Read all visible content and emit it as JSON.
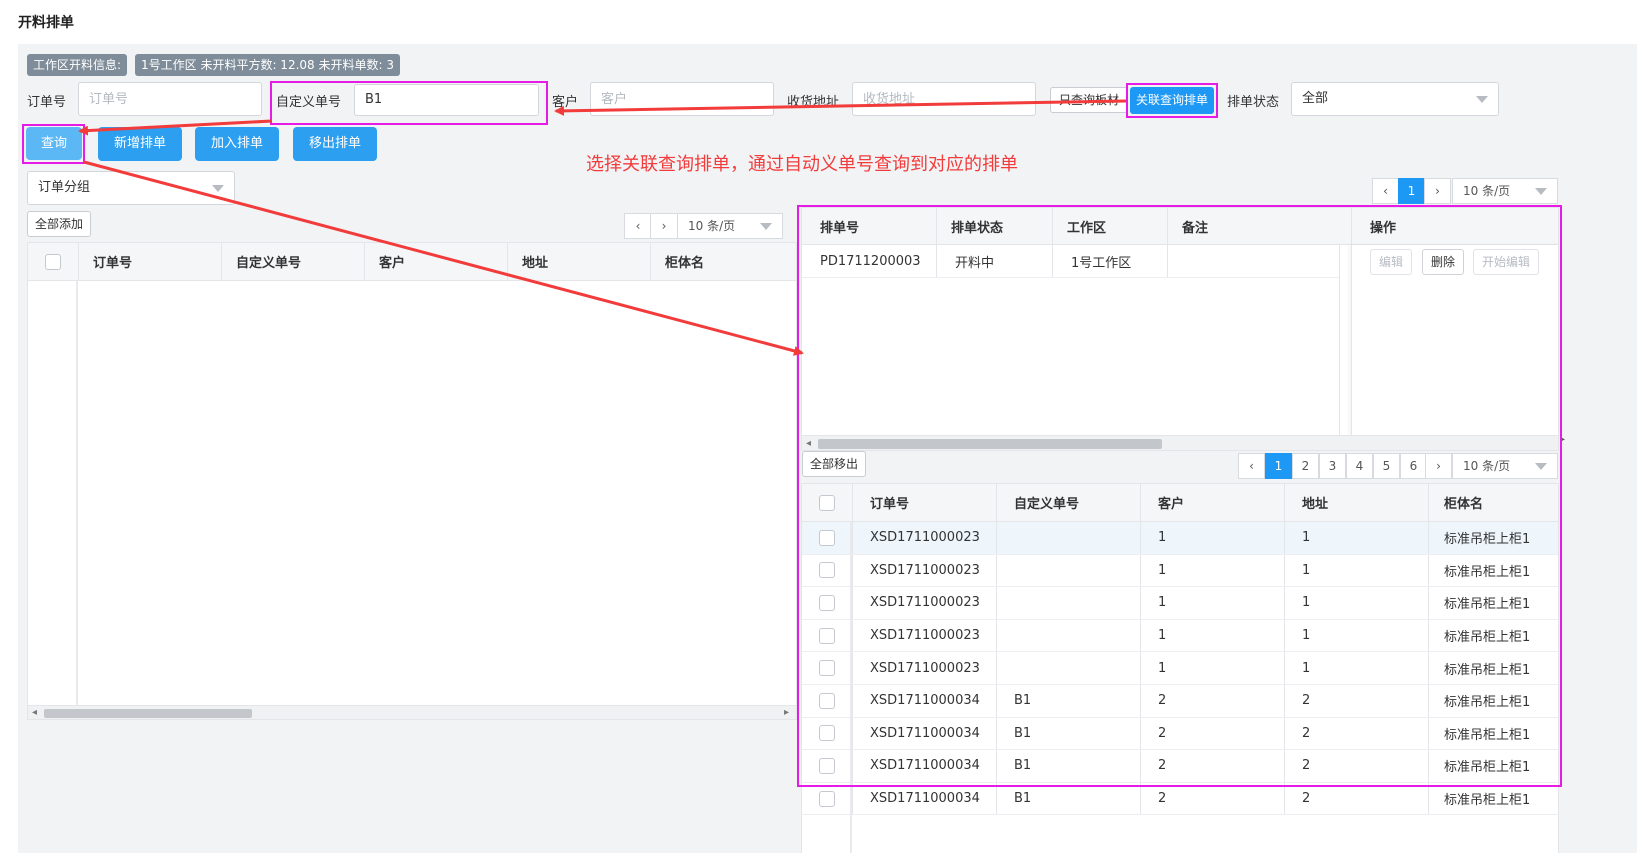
{
  "page": {
    "title": "开料排单"
  },
  "info": {
    "label": "工作区开料信息:",
    "value": "1号工作区 未开料平方数: 12.08 未开料单数: 3"
  },
  "filters": {
    "order_no": {
      "label": "订单号",
      "placeholder": "订单号"
    },
    "custom_no": {
      "label": "自定义单号",
      "value": "B1"
    },
    "customer": {
      "label": "客户",
      "placeholder": "客户"
    },
    "address": {
      "label": "收货地址",
      "placeholder": "收货地址"
    },
    "only_board": "只查询板材",
    "linked_query": "关联查询排单",
    "status": {
      "label": "排单状态",
      "value": "全部"
    }
  },
  "actions": {
    "query": "查询",
    "new": "新增排单",
    "add": "加入排单",
    "remove": "移出排单"
  },
  "annotation": "选择关联查询排单，通过自动义单号查询到对应的排单",
  "left": {
    "group_select": "订单分组",
    "add_all": "全部添加",
    "page_size": "10 条/页",
    "headers": [
      "订单号",
      "自定义单号",
      "客户",
      "地址",
      "柜体名"
    ]
  },
  "right_top": {
    "page": "1",
    "page_size": "10 条/页",
    "headers": [
      "排单号",
      "排单状态",
      "工作区",
      "备注",
      "操作"
    ],
    "rows": [
      {
        "no": "PD1711200003",
        "status": "开料中",
        "zone": "1号工作区",
        "note": ""
      }
    ],
    "ops": [
      "编辑",
      "删除",
      "开始编辑"
    ]
  },
  "right_bottom": {
    "remove_all": "全部移出",
    "pages": [
      "1",
      "2",
      "3",
      "4",
      "5",
      "6"
    ],
    "page_size": "10 条/页",
    "headers": [
      "订单号",
      "自定义单号",
      "客户",
      "地址",
      "柜体名"
    ],
    "rows": [
      {
        "order": "XSD1711000023",
        "custom": "",
        "customer": "1",
        "addr": "1",
        "cabinet": "标准吊柜上柜1"
      },
      {
        "order": "XSD1711000023",
        "custom": "",
        "customer": "1",
        "addr": "1",
        "cabinet": "标准吊柜上柜1"
      },
      {
        "order": "XSD1711000023",
        "custom": "",
        "customer": "1",
        "addr": "1",
        "cabinet": "标准吊柜上柜1"
      },
      {
        "order": "XSD1711000023",
        "custom": "",
        "customer": "1",
        "addr": "1",
        "cabinet": "标准吊柜上柜1"
      },
      {
        "order": "XSD1711000023",
        "custom": "",
        "customer": "1",
        "addr": "1",
        "cabinet": "标准吊柜上柜1"
      },
      {
        "order": "XSD1711000034",
        "custom": "B1",
        "customer": "2",
        "addr": "2",
        "cabinet": "标准吊柜上柜1"
      },
      {
        "order": "XSD1711000034",
        "custom": "B1",
        "customer": "2",
        "addr": "2",
        "cabinet": "标准吊柜上柜1"
      },
      {
        "order": "XSD1711000034",
        "custom": "B1",
        "customer": "2",
        "addr": "2",
        "cabinet": "标准吊柜上柜1"
      },
      {
        "order": "XSD1711000034",
        "custom": "B1",
        "customer": "2",
        "addr": "2",
        "cabinet": "标准吊柜上柜1"
      }
    ]
  },
  "colors": {
    "accent": "#2d9ff0",
    "highlight_box": "#e61be6",
    "arrow": "#f23b3b"
  }
}
